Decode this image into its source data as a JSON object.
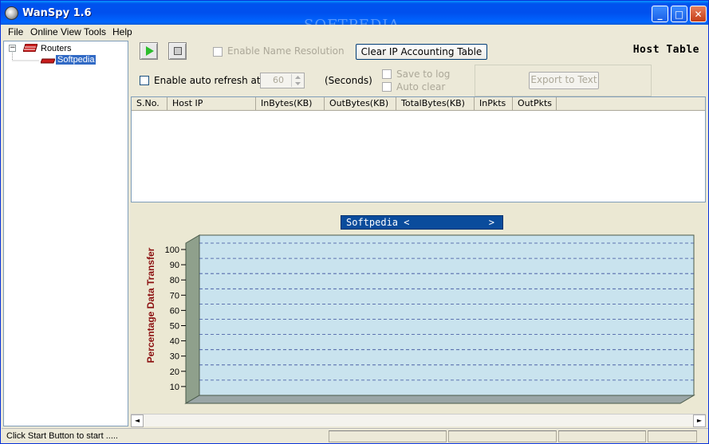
{
  "window": {
    "title": "WanSpy 1.6",
    "watermark": "SOFTPEDIA",
    "controls": {
      "minimize": "_",
      "maximize": "□",
      "close": "✕"
    }
  },
  "menu": [
    "File",
    "Online View",
    "Tools",
    "Help"
  ],
  "tree": {
    "root": "Routers",
    "children": [
      "Softpedia"
    ],
    "expander": "−"
  },
  "toolbar": {
    "enable_name_resolution": "Enable Name Resolution",
    "clear_button": "Clear IP Accounting Table",
    "host_table_title": "Host Table",
    "enable_auto_refresh": "Enable auto refresh at",
    "refresh_value": "60",
    "seconds_label": "(Seconds)",
    "save_to_log": "Save to log",
    "auto_clear": "Auto clear",
    "export_button": "Export to Text"
  },
  "table": {
    "columns": [
      "S.No.",
      "Host IP",
      "InBytes(KB)",
      "OutBytes(KB)",
      "TotalBytes(KB)",
      "InPkts",
      "OutPkts"
    ],
    "rows": []
  },
  "chart_data": {
    "type": "bar",
    "series_selector": "Softpedia <",
    "series_selector_arrow": ">",
    "ylabel": "Percentage Data Transfer",
    "ylim": [
      0,
      100
    ],
    "yticks": [
      10,
      20,
      30,
      40,
      50,
      60,
      70,
      80,
      90,
      100
    ],
    "grid": true,
    "categories": [],
    "values": [],
    "colors": {
      "plot_face": "#c9e3ee",
      "wall": "#8fa08c",
      "floor": "#9aa6a6",
      "grid": "#3a4f9c"
    }
  },
  "scrollbar": {
    "left": "◄",
    "right": "►"
  },
  "status": {
    "message": "Click Start Button to start ....."
  },
  "colors": {
    "title_bar": "#0054e3",
    "selection": "#316ac5",
    "axis_label": "#8b1010"
  }
}
